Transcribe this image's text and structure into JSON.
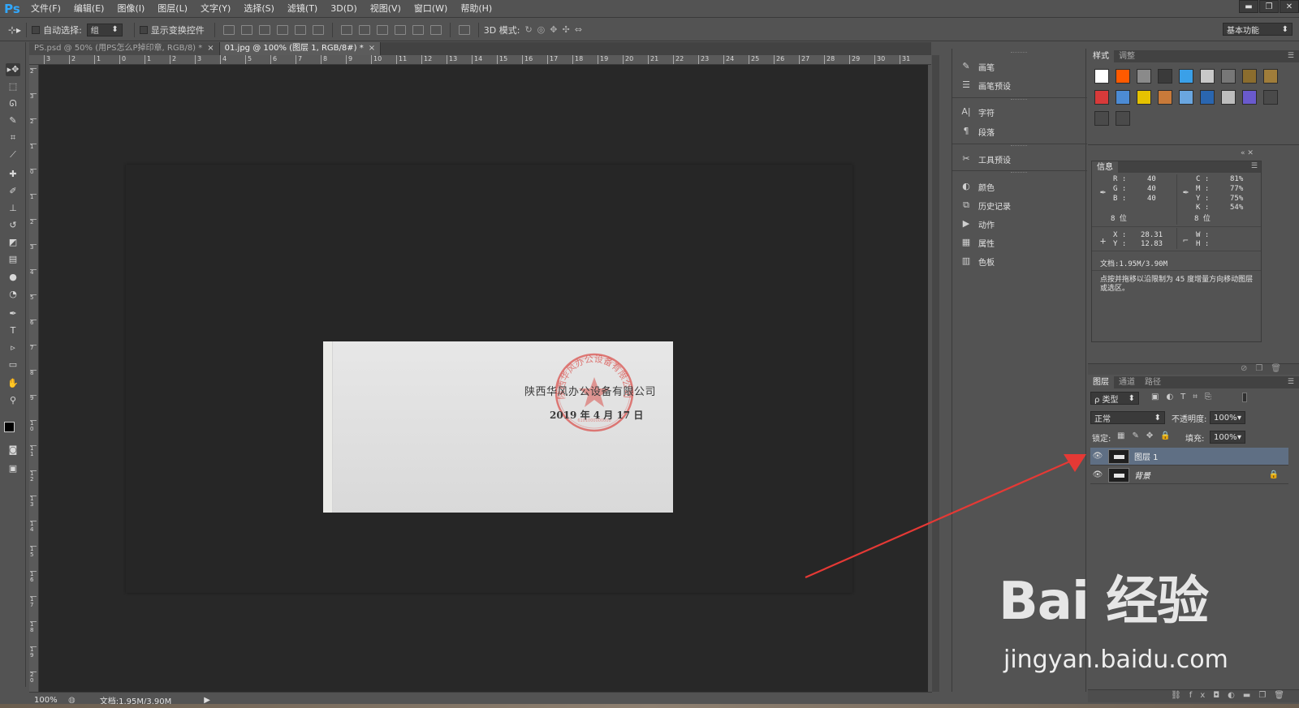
{
  "app": {
    "logo": "Ps"
  },
  "menu": [
    "文件(F)",
    "编辑(E)",
    "图像(I)",
    "图层(L)",
    "文字(Y)",
    "选择(S)",
    "滤镜(T)",
    "3D(D)",
    "视图(V)",
    "窗口(W)",
    "帮助(H)"
  ],
  "window_controls": [
    "▬",
    "❐",
    "✕"
  ],
  "options": {
    "auto_select_label": "自动选择:",
    "auto_select_value": "组",
    "show_transform_label": "显示变换控件",
    "mode3d_label": "3D 模式:",
    "workspace": "基本功能"
  },
  "tabs": [
    {
      "title": "PS.psd @ 50% (用PS怎么P掉印章, RGB/8) *",
      "close": "×"
    },
    {
      "title": "01.jpg @ 100% (图层 1, RGB/8#) *",
      "close": "×"
    }
  ],
  "ruler": {
    "h_ticks": [
      "3",
      "2",
      "1",
      "0",
      "1",
      "2",
      "3",
      "4",
      "5",
      "6",
      "7",
      "8",
      "9",
      "10",
      "11",
      "12",
      "13",
      "14",
      "15",
      "16",
      "17",
      "18",
      "19",
      "20",
      "21",
      "22",
      "23",
      "24",
      "25",
      "26",
      "27",
      "28",
      "29",
      "30",
      "31"
    ],
    "v_ticks": [
      "2",
      "3",
      "2",
      "1",
      "0",
      "1",
      "2",
      "3",
      "4",
      "5",
      "6",
      "7",
      "8",
      "9",
      "1 0",
      "1 1",
      "1 2",
      "1 3",
      "1 4",
      "1 5",
      "1 6",
      "1 7",
      "1 8",
      "1 9",
      "2 0"
    ]
  },
  "document": {
    "company": "陕西华风办公设备有限公司",
    "date": "2019 年 4 月 17 日",
    "stamp_text": "陕西华风办公设备有限公司",
    "stamp_code": "6101000000000",
    "stamp_color": "#d9534f"
  },
  "status": {
    "zoom": "100%",
    "doc": "文档:1.95M/3.90M"
  },
  "dock": {
    "items": [
      "画笔",
      "画笔预设",
      "字符",
      "段落",
      "工具预设",
      "颜色",
      "历史记录",
      "动作",
      "属性",
      "色板"
    ]
  },
  "styles_panel": {
    "tabs": [
      "样式",
      "调整"
    ],
    "swatch_colors": [
      "#ffffff",
      "#ff5a00",
      "#8a8a8a",
      "#3a3a3a",
      "#3aa0e8",
      "#c8c8c8",
      "#777777",
      "#8b6d2e",
      "#a07d3a",
      "#d83a3a",
      "#4c8bd4",
      "#e6c200",
      "#c87a3a",
      "#6aa6e0",
      "#2a66b0",
      "#bdbdbd",
      "#6a5acd",
      "#4a4a4a",
      "#4a4a4a",
      "#4a4a4a"
    ]
  },
  "info_panel": {
    "title": "信息",
    "rgb": {
      "r_label": "R :",
      "r": "40",
      "g_label": "G :",
      "g": "40",
      "b_label": "B :",
      "b": "40"
    },
    "cmyk": {
      "c_label": "C :",
      "c": "81%",
      "m_label": "M :",
      "m": "77%",
      "y_label": "Y :",
      "y": "75%",
      "k_label": "K :",
      "k": "54%"
    },
    "bits_left": "8 位",
    "bits_right": "8 位",
    "x_label": "X :",
    "x": "28.31",
    "y_label": "Y :",
    "y": "12.83",
    "w_label": "W :",
    "h_label": "H :",
    "doc": "文档:1.95M/3.90M",
    "hint": "点按并拖移以沿限制为 45 度增量方向移动图层或选区。"
  },
  "layers_panel": {
    "tabs": [
      "图层",
      "通道",
      "路径"
    ],
    "filter": "ρ 类型",
    "blend_mode": "正常",
    "opacity_label": "不透明度:",
    "opacity": "100%",
    "lock_label": "锁定:",
    "fill_label": "填充:",
    "fill": "100%",
    "layers": [
      {
        "name": "图层 1",
        "selected": true
      },
      {
        "name": "背景",
        "selected": false
      }
    ],
    "footer_icons": [
      "link-icon",
      "fx-icon",
      "mask-icon",
      "adjustment-icon",
      "folder-icon",
      "new-layer-icon",
      "trash-icon"
    ]
  },
  "watermark": {
    "logo": "Bai 经验",
    "url": "jingyan.baidu.com"
  },
  "colors": {
    "annotation_arrow": "#e53935",
    "selection": "#5f6f84",
    "canvas_bg": "#282828"
  }
}
